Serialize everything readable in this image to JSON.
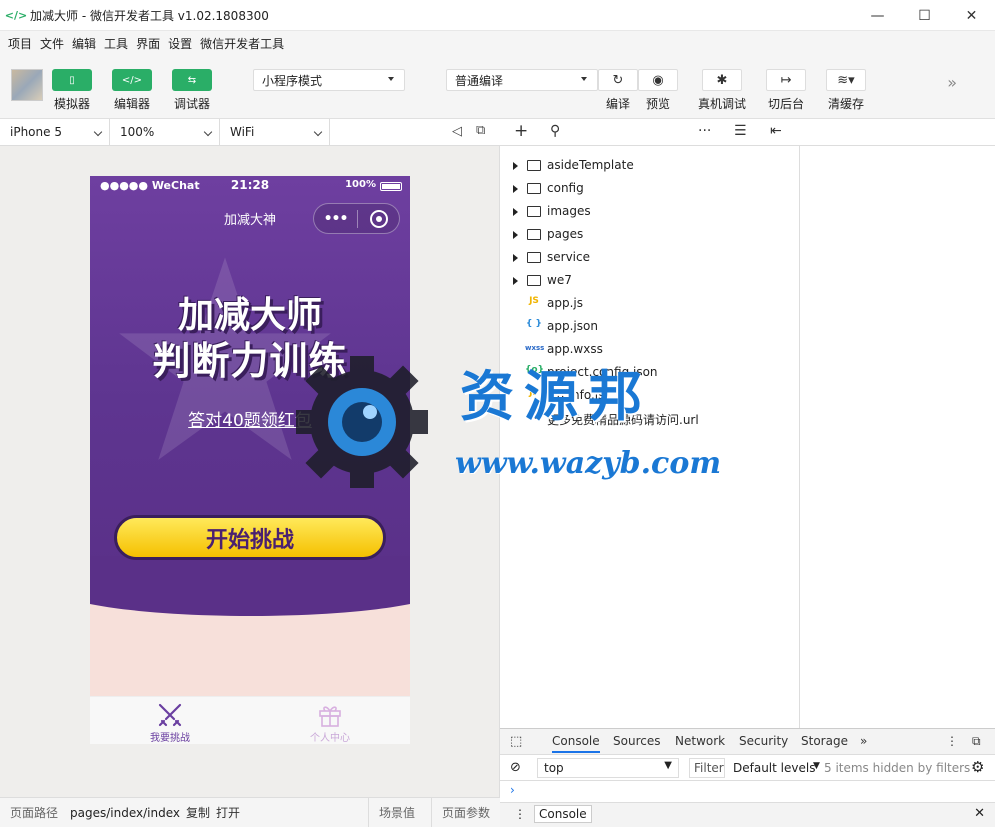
{
  "window": {
    "title": "加减大师 - 微信开发者工具 v1.02.1808300",
    "min": "—",
    "max": "☐",
    "close": "✕"
  },
  "menu": [
    "项目",
    "文件",
    "编辑",
    "工具",
    "界面",
    "设置",
    "微信开发者工具"
  ],
  "toolbar": {
    "simulator": "模拟器",
    "editor": "编辑器",
    "debugger": "调试器",
    "mode": "小程序模式",
    "compile_mode": "普通编译",
    "compile": "编译",
    "preview": "预览",
    "remote_debug": "真机调试",
    "background": "切后台",
    "clear_cache": "清缓存"
  },
  "simulator": {
    "device": "iPhone 5",
    "zoom": "100%",
    "network": "WiFi"
  },
  "phone": {
    "carrier": "●●●●● WeChat",
    "time": "21:28",
    "battery": "100%",
    "nav_title": "加减大神",
    "capsule_dots": "•••",
    "logo_line1": "加减大师",
    "logo_line2": "判断力训练",
    "red_packet": "答对40题领红包",
    "start_button": "开始挑战",
    "tabs": [
      {
        "label": "我要挑战",
        "active": true
      },
      {
        "label": "个人中心",
        "active": false
      }
    ]
  },
  "tree": {
    "folders": [
      "asideTemplate",
      "config",
      "images",
      "pages",
      "service",
      "we7"
    ],
    "files": [
      {
        "type": "JS",
        "name": "app.js",
        "color": "#f0b400"
      },
      {
        "type": "{ }",
        "name": "app.json",
        "color": "#2a8ad8"
      },
      {
        "type": "wxss",
        "name": "app.wxss",
        "color": "#2a6ac8"
      },
      {
        "type": "{o}",
        "name": "project.config.json",
        "color": "#2aae67"
      },
      {
        "type": "JS",
        "name": "siteinfo.js",
        "color": "#f0b400"
      },
      {
        "type": "",
        "name": "更多免费精品源码请访问.url",
        "color": "#333"
      }
    ]
  },
  "devtools": {
    "tabs": [
      "Console",
      "Sources",
      "Network",
      "Security",
      "Storage"
    ],
    "context": "top",
    "filter": "Filter",
    "levels": "Default levels",
    "hidden": "5 items hidden by filters",
    "drawer_tab": "Console"
  },
  "statusbar": {
    "path_label": "页面路径",
    "path": "pages/index/index",
    "copy": "复制",
    "open": "打开",
    "scene": "场景值",
    "params": "页面参数"
  },
  "watermark": {
    "text": "资源邦",
    "url": "www.wazyb.com"
  }
}
